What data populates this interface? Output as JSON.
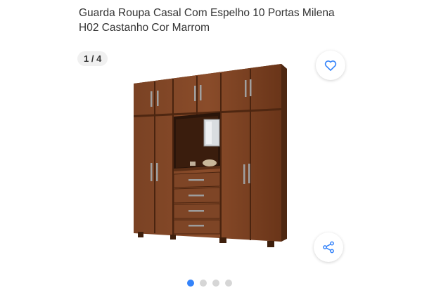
{
  "product": {
    "title": "Guarda Roupa Casal Com Espelho 10 Portas Milena H02 Castanho Cor Marrom"
  },
  "gallery": {
    "counter": "1 / 4",
    "current": 1,
    "total": 4,
    "image_alt_icon": "wardrobe-image"
  },
  "actions": {
    "favorite_icon": "heart-icon",
    "share_icon": "share-icon"
  },
  "colors": {
    "accent": "#3483fa",
    "dot_inactive": "#d6d6d6",
    "wood": "#6f3a1e"
  }
}
